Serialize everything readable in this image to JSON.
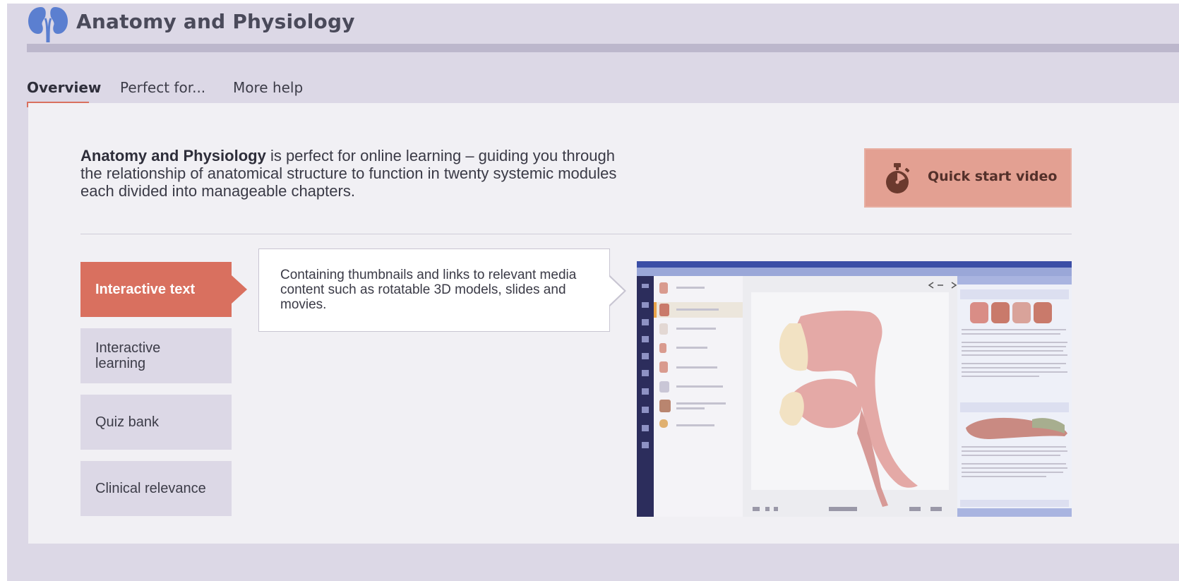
{
  "header": {
    "title": "Anatomy and Physiology",
    "logo_icon": "kidneys-icon",
    "brand_color": "#5b7fd0"
  },
  "tabs": [
    {
      "label": "Overview",
      "active": true
    },
    {
      "label": "Perfect for...",
      "active": false
    },
    {
      "label": "More help",
      "active": false
    }
  ],
  "intro": {
    "bold": "Anatomy and Physiology",
    "text": " is perfect for online learning – guiding you through the relationship of anatomical structure to function in twenty systemic modules each divided into manageable chapters."
  },
  "quick_start": {
    "label": "Quick start video",
    "icon": "stopwatch-icon"
  },
  "features": [
    {
      "label": "Interactive text",
      "active": true
    },
    {
      "label": "Interactive learning",
      "active": false
    },
    {
      "label": "Quiz bank",
      "active": false
    },
    {
      "label": "Clinical relevance",
      "active": false
    }
  ],
  "callout": {
    "text": "Containing thumbnails and links to relevant media content such as rotatable 3D models, slides and movies."
  },
  "screenshot": {
    "description_icon": "app-screenshot-3d-airway",
    "accent_color": "#d9705f",
    "nav_color": "#2c2d5c"
  }
}
